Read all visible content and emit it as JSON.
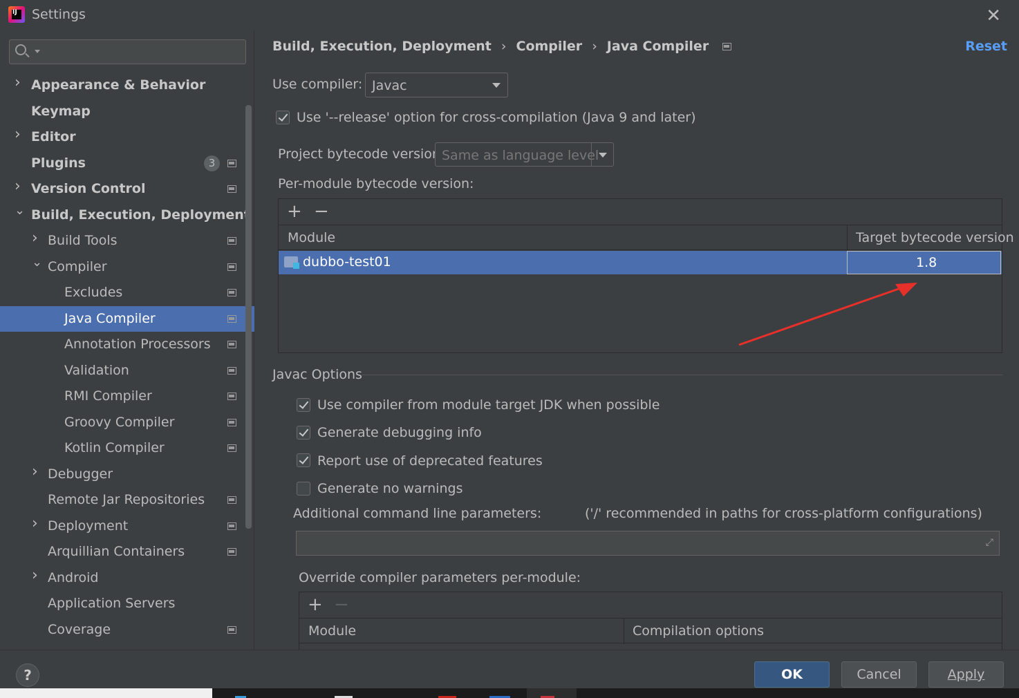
{
  "window": {
    "title": "Settings"
  },
  "sidebar": {
    "search": {
      "placeholder": "",
      "value": ""
    },
    "items": [
      {
        "label": "Appearance & Behavior",
        "level": 0,
        "arrow": "collapsed",
        "bold": true,
        "project": false
      },
      {
        "label": "Keymap",
        "level": 0,
        "arrow": "none",
        "bold": true,
        "project": false
      },
      {
        "label": "Editor",
        "level": 0,
        "arrow": "collapsed",
        "bold": true,
        "project": false
      },
      {
        "label": "Plugins",
        "level": 0,
        "arrow": "none",
        "bold": true,
        "project": true,
        "badge": "3"
      },
      {
        "label": "Version Control",
        "level": 0,
        "arrow": "collapsed",
        "bold": true,
        "project": true
      },
      {
        "label": "Build, Execution, Deployment",
        "level": 0,
        "arrow": "expanded",
        "bold": true,
        "project": false
      },
      {
        "label": "Build Tools",
        "level": 1,
        "arrow": "collapsed",
        "bold": false,
        "project": true
      },
      {
        "label": "Compiler",
        "level": 1,
        "arrow": "expanded",
        "bold": false,
        "project": true
      },
      {
        "label": "Excludes",
        "level": 2,
        "arrow": "none",
        "bold": false,
        "project": true
      },
      {
        "label": "Java Compiler",
        "level": 2,
        "arrow": "none",
        "bold": false,
        "project": true,
        "selected": true
      },
      {
        "label": "Annotation Processors",
        "level": 2,
        "arrow": "none",
        "bold": false,
        "project": true
      },
      {
        "label": "Validation",
        "level": 2,
        "arrow": "none",
        "bold": false,
        "project": true
      },
      {
        "label": "RMI Compiler",
        "level": 2,
        "arrow": "none",
        "bold": false,
        "project": true
      },
      {
        "label": "Groovy Compiler",
        "level": 2,
        "arrow": "none",
        "bold": false,
        "project": true
      },
      {
        "label": "Kotlin Compiler",
        "level": 2,
        "arrow": "none",
        "bold": false,
        "project": true
      },
      {
        "label": "Debugger",
        "level": 1,
        "arrow": "collapsed",
        "bold": false,
        "project": false
      },
      {
        "label": "Remote Jar Repositories",
        "level": 1,
        "arrow": "none",
        "bold": false,
        "project": true
      },
      {
        "label": "Deployment",
        "level": 1,
        "arrow": "collapsed",
        "bold": false,
        "project": true
      },
      {
        "label": "Arquillian Containers",
        "level": 1,
        "arrow": "none",
        "bold": false,
        "project": true
      },
      {
        "label": "Android",
        "level": 1,
        "arrow": "collapsed",
        "bold": false,
        "project": false
      },
      {
        "label": "Application Servers",
        "level": 1,
        "arrow": "none",
        "bold": false,
        "project": false
      },
      {
        "label": "Coverage",
        "level": 1,
        "arrow": "none",
        "bold": false,
        "project": true
      }
    ]
  },
  "breadcrumb": [
    "Build, Execution, Deployment",
    "Compiler",
    "Java Compiler"
  ],
  "reset_label": "Reset",
  "use_compiler": {
    "label": "Use compiler:",
    "value": "Javac"
  },
  "release_option": {
    "label": "Use '--release' option for cross-compilation (Java 9 and later)",
    "checked": true
  },
  "project_bytecode": {
    "label": "Project bytecode version:",
    "value": "Same as language level"
  },
  "per_module": {
    "label": "Per-module bytecode version:",
    "columns": [
      "Module",
      "Target bytecode version"
    ],
    "rows": [
      {
        "module": "dubbo-test01",
        "version": "1.8"
      }
    ]
  },
  "javac_options": {
    "section_label": "Javac Options",
    "checkboxes": [
      {
        "label": "Use compiler from module target JDK when possible",
        "checked": true
      },
      {
        "label": "Generate debugging info",
        "checked": true
      },
      {
        "label": "Report use of deprecated features",
        "checked": true
      },
      {
        "label": "Generate no warnings",
        "checked": false
      }
    ],
    "additional_params_label": "Additional command line parameters:",
    "additional_params_hint": "('/' recommended in paths for cross-platform configurations)",
    "additional_params_value": "",
    "override_label": "Override compiler parameters per-module:",
    "override_columns": [
      "Module",
      "Compilation options"
    ]
  },
  "buttons": {
    "ok": "OK",
    "cancel": "Cancel",
    "apply": "Apply"
  },
  "colors": {
    "accent": "#4b6eaf",
    "link": "#589df6",
    "annotation_arrow": "#e8302a",
    "background": "#3c3f41"
  }
}
